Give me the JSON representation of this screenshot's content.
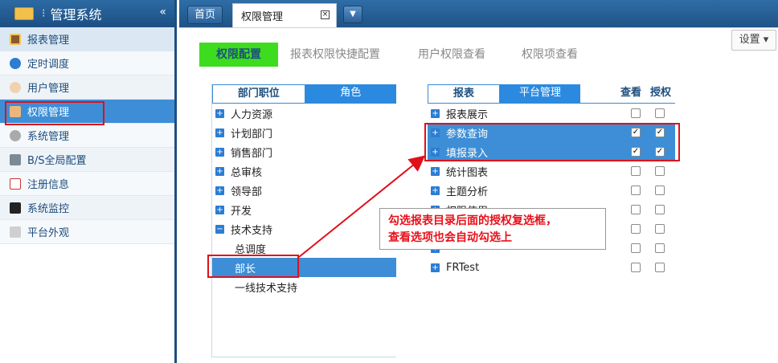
{
  "app": {
    "title": "管理系统",
    "collapse_glyph": "«"
  },
  "sidebar": {
    "items": [
      {
        "label": "报表管理",
        "icon": "report-icon"
      },
      {
        "label": "定时调度",
        "icon": "clock-icon"
      },
      {
        "label": "用户管理",
        "icon": "user-icon"
      },
      {
        "label": "权限管理",
        "icon": "permission-icon"
      },
      {
        "label": "系统管理",
        "icon": "gear-icon"
      },
      {
        "label": "B/S全局配置",
        "icon": "server-icon"
      },
      {
        "label": "注册信息",
        "icon": "register-icon"
      },
      {
        "label": "系统监控",
        "icon": "monitor-icon"
      },
      {
        "label": "平台外观",
        "icon": "appearance-icon"
      }
    ]
  },
  "tabs": {
    "home": "首页",
    "current": "权限管理",
    "close_glyph": "×"
  },
  "settings": {
    "label": "设置 ▾"
  },
  "subtabs": [
    "权限配置",
    "报表权限快捷配置",
    "用户权限查看",
    "权限项查看"
  ],
  "left_panel": {
    "tab_dept": "部门职位",
    "tab_role": "角色",
    "tree": [
      {
        "label": "人力资源",
        "toggle": "+"
      },
      {
        "label": "计划部门",
        "toggle": "+"
      },
      {
        "label": "销售部门",
        "toggle": "+"
      },
      {
        "label": "总审核",
        "toggle": "+"
      },
      {
        "label": "领导部",
        "toggle": "+"
      },
      {
        "label": "开发",
        "toggle": "+"
      },
      {
        "label": "技术支持",
        "toggle": "−"
      }
    ],
    "children": [
      "总调度",
      "部长",
      "一线技术支持"
    ]
  },
  "right_panel": {
    "tab_report": "报表",
    "tab_platform": "平台管理",
    "col_view": "查看",
    "col_auth": "授权",
    "rows": [
      {
        "label": "报表展示",
        "view": "",
        "auth": ""
      },
      {
        "label": "参数查询",
        "view": "✓",
        "auth": "✓"
      },
      {
        "label": "填报录入",
        "view": "✓",
        "auth": "✓"
      },
      {
        "label": "统计图表",
        "view": "",
        "auth": ""
      },
      {
        "label": "主题分析",
        "view": "",
        "auth": ""
      },
      {
        "label": "权限使用",
        "view": "",
        "auth": ""
      },
      {
        "label": "",
        "view": "",
        "auth": ""
      },
      {
        "label": "",
        "view": "",
        "auth": ""
      },
      {
        "label": "FRTest",
        "view": "",
        "auth": ""
      }
    ]
  },
  "annotation": {
    "line1": "勾选报表目录后面的授权复选框，",
    "line2": "查看选项也会自动勾选上"
  },
  "colors": {
    "accent": "#3d8ed6",
    "header": "#1e5386",
    "highlight": "#e0101a",
    "green": "#3ddc1e"
  }
}
